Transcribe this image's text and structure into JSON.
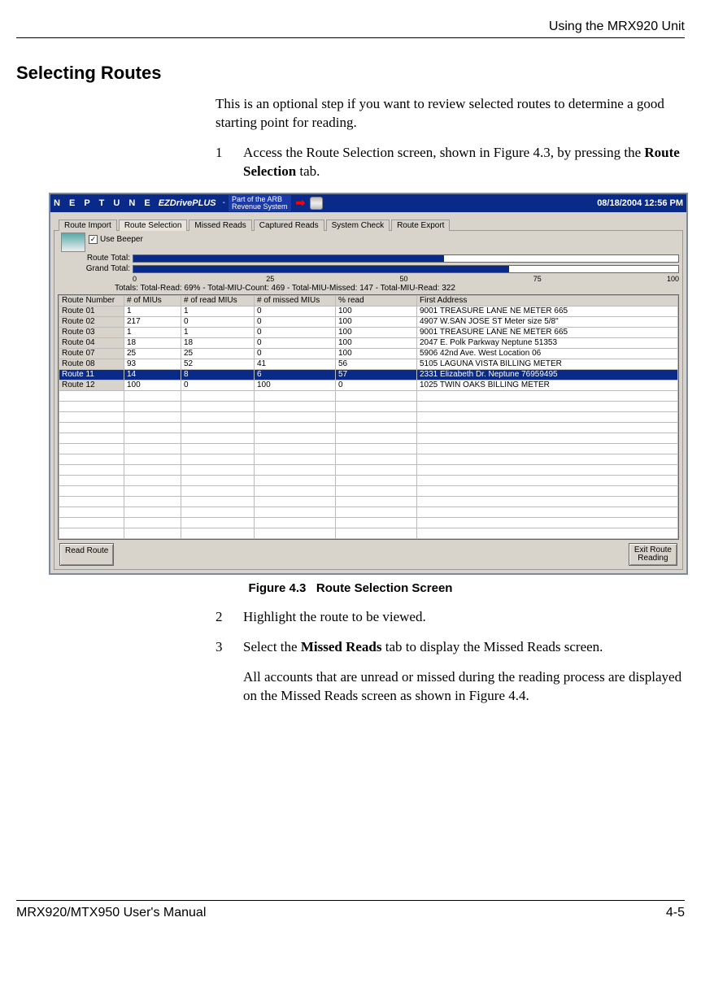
{
  "header": {
    "running_head": "Using the MRX920 Unit"
  },
  "section": {
    "title": "Selecting Routes"
  },
  "intro": "This is an optional step if you want to review selected routes to determine a good starting point for reading.",
  "steps": {
    "s1_num": "1",
    "s1_a": "Access the Route Selection screen, shown in Figure 4.3, by pressing the ",
    "s1_b": "Route Selection",
    "s1_c": " tab.",
    "s2_num": "2",
    "s2": "Highlight the route to be viewed.",
    "s3_num": "3",
    "s3_a": "Select the ",
    "s3_b": "Missed Reads",
    "s3_c": " tab to display the Missed Reads screen.",
    "s3_p2": "All accounts that are unread or missed during the reading process are displayed on the Missed Reads screen as shown in Figure 4.4."
  },
  "figure": {
    "caption_label": "Figure 4.3",
    "caption_text": "Route Selection Screen"
  },
  "app": {
    "brand1": "N E P T U N E",
    "brand2": "EZDrivePLUS",
    "dash": "-",
    "tagline1": "Part of the ARB",
    "tagline2": "Revenue System",
    "datetime": "08/18/2004 12:56 PM",
    "tabs": [
      "Route Import",
      "Route Selection",
      "Missed Reads",
      "Captured Reads",
      "System Check",
      "Route Export"
    ],
    "use_beeper": "Use Beeper",
    "check": "✓",
    "bar_labels": {
      "route": "Route Total:",
      "grand": "Grand Total:",
      "totals": "Totals:"
    },
    "scale": [
      "0",
      "25",
      "50",
      "75",
      "100"
    ],
    "totals_line": "Total-Read: 69%  -  Total-MIU-Count: 469  -  Total-MIU-Missed: 147  -  Total-MIU-Read: 322",
    "columns": [
      "Route Number",
      "# of MIUs",
      "# of read MIUs",
      "# of missed MIUs",
      "% read",
      "First Address"
    ],
    "rows": [
      {
        "name": "Route 01",
        "miu": "1",
        "read": "1",
        "miss": "0",
        "pct": "100",
        "addr": "9001 TREASURE LANE NE    METER 665"
      },
      {
        "name": "Route 02",
        "miu": "217",
        "read": "0",
        "miss": "0",
        "pct": "100",
        "addr": "4907 W.SAN JOSE ST      Meter size  5/8\""
      },
      {
        "name": "Route 03",
        "miu": "1",
        "read": "1",
        "miss": "0",
        "pct": "100",
        "addr": "9001 TREASURE LANE NE    METER 665"
      },
      {
        "name": "Route 04",
        "miu": "18",
        "read": "18",
        "miss": "0",
        "pct": "100",
        "addr": "2047 E. Polk Parkway     Neptune 51353"
      },
      {
        "name": "Route 07",
        "miu": "25",
        "read": "25",
        "miss": "0",
        "pct": "100",
        "addr": "5906 42nd Ave. West      Location 06"
      },
      {
        "name": "Route 08",
        "miu": "93",
        "read": "52",
        "miss": "41",
        "pct": "56",
        "addr": "5105 LAGUNA VISTA       BILLING METER"
      },
      {
        "name": "Route 11",
        "miu": "14",
        "read": "8",
        "miss": "6",
        "pct": "57",
        "addr": "2331 Elizabeth Dr.       Neptune 76959495"
      },
      {
        "name": "Route 12",
        "miu": "100",
        "read": "0",
        "miss": "100",
        "pct": "0",
        "addr": "1025 TWIN OAKS          BILLING METER"
      }
    ],
    "btn_read": "Read Route",
    "btn_exit1": "Exit Route",
    "btn_exit2": "Reading"
  },
  "footer": {
    "left": "MRX920/MTX950 User's Manual",
    "right": "4-5"
  },
  "chart_data": {
    "type": "bar",
    "title": "Route / Grand Total progress",
    "series": [
      {
        "name": "Route Total",
        "value_pct": 57
      },
      {
        "name": "Grand Total",
        "value_pct": 69
      }
    ],
    "xlim": [
      0,
      100
    ],
    "ticks": [
      0,
      25,
      50,
      75,
      100
    ],
    "totals": {
      "read_pct": 69,
      "miu_count": 469,
      "miu_missed": 147,
      "miu_read": 322
    }
  }
}
